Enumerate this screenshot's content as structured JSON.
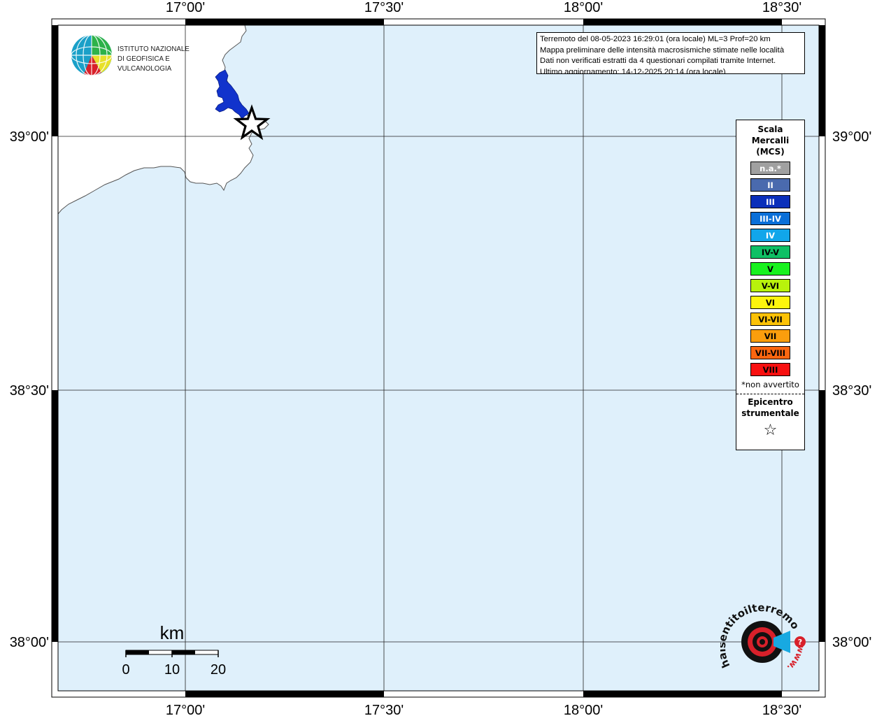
{
  "map": {
    "lon_labels": [
      "17°00'",
      "17°30'",
      "18°00'",
      "18°30'"
    ],
    "lat_labels": [
      "39°00'",
      "38°30'",
      "38°00'"
    ],
    "colors": {
      "sea": "#dff0fb",
      "land": "#ffffff",
      "intensity_region": "#1133cc"
    },
    "epicenter_marker": "star-icon"
  },
  "info": {
    "line1": "Terremoto del 08-05-2023 16:29:01 (ora locale) ML=3 Prof=20 km",
    "line2": "Mappa preliminare delle intensità macrosismiche stimate nelle località",
    "line3": "Dati non verificati estratti da 4 questionari compilati tramite Internet.",
    "line4": "Ultimo aggiornamento: 14-12-2025 20:14 (ora locale)"
  },
  "legend": {
    "title_line1": "Scala",
    "title_line2": "Mercalli",
    "title_line3": "(MCS)",
    "items": [
      {
        "label": "n.a.*",
        "color": "#a0a0a0",
        "text_color": "#ffffff"
      },
      {
        "label": "II",
        "color": "#4a6aae",
        "text_color": "#ffffff"
      },
      {
        "label": "III",
        "color": "#0a2fba",
        "text_color": "#ffffff"
      },
      {
        "label": "III-IV",
        "color": "#0a6fd8",
        "text_color": "#ffffff"
      },
      {
        "label": "IV",
        "color": "#11a6ea",
        "text_color": "#ffffff"
      },
      {
        "label": "IV-V",
        "color": "#0fc065",
        "text_color": "#000000"
      },
      {
        "label": "V",
        "color": "#18f21e",
        "text_color": "#000000"
      },
      {
        "label": "V-VI",
        "color": "#b8f20c",
        "text_color": "#000000"
      },
      {
        "label": "VI",
        "color": "#fdf50d",
        "text_color": "#000000"
      },
      {
        "label": "VI-VII",
        "color": "#fcc207",
        "text_color": "#000000"
      },
      {
        "label": "VII",
        "color": "#fb9e0d",
        "text_color": "#000000"
      },
      {
        "label": "VII-VIII",
        "color": "#fa6610",
        "text_color": "#000000"
      },
      {
        "label": "VIII",
        "color": "#f81010",
        "text_color": "#000000"
      }
    ],
    "note": "*non avvertito",
    "epicenter_line1": "Epicentro",
    "epicenter_line2": "strumentale",
    "epicenter_icon": "☆"
  },
  "scale_bar": {
    "unit": "km",
    "ticks": [
      "0",
      "10",
      "20"
    ]
  },
  "logos": {
    "ingv_line1": "ISTITUTO NAZIONALE",
    "ingv_line2": "DI GEOFISICA E VULCANOLOGIA",
    "hst_text": "haisentitoilterremoto.it",
    "hst_prefix": "www."
  }
}
